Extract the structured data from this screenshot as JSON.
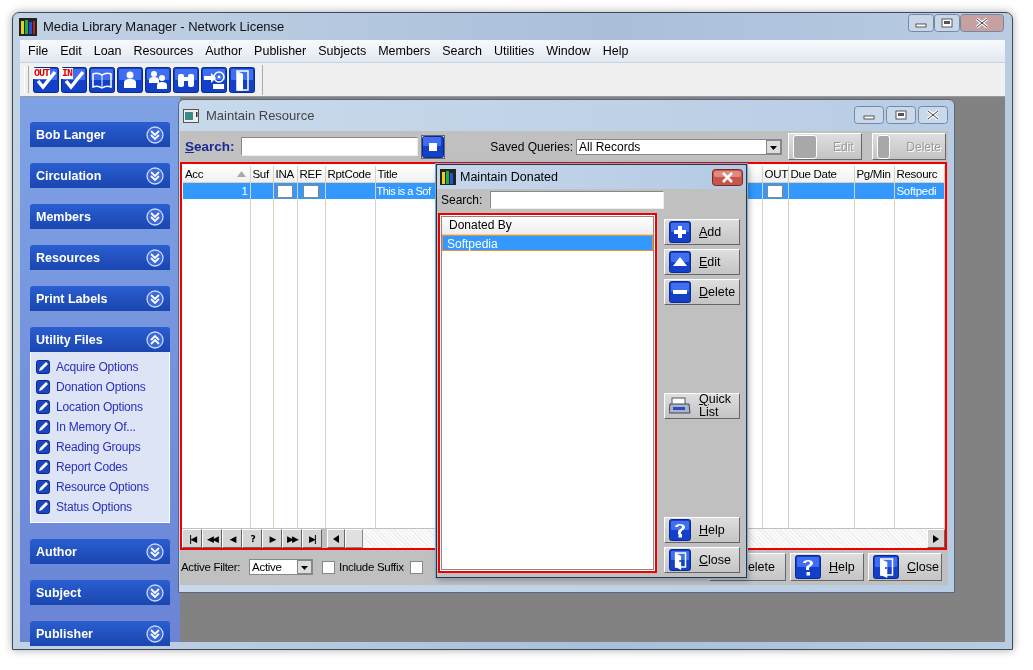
{
  "window": {
    "title": "Media Library Manager - Network License"
  },
  "menu": [
    "File",
    "Edit",
    "Loan",
    "Resources",
    "Author",
    "Publisher",
    "Subjects",
    "Members",
    "Search",
    "Utilities",
    "Window",
    "Help"
  ],
  "toolbar": [
    {
      "kind": "out",
      "label": "OUT"
    },
    {
      "kind": "in",
      "label": "IN"
    },
    {
      "kind": "book"
    },
    {
      "kind": "person"
    },
    {
      "kind": "people"
    },
    {
      "kind": "binoculars"
    },
    {
      "kind": "import"
    },
    {
      "kind": "door"
    }
  ],
  "sidebar": [
    {
      "title": "Bob Langer",
      "expanded": false
    },
    {
      "title": "Circulation",
      "expanded": false
    },
    {
      "title": "Members",
      "expanded": false
    },
    {
      "title": "Resources",
      "expanded": false
    },
    {
      "title": "Print Labels",
      "expanded": false
    },
    {
      "title": "Utility Files",
      "expanded": true,
      "items": [
        "Acquire Options",
        "Donation Options",
        "Location Options",
        "In Memory Of...",
        "Reading Groups",
        "Report Codes",
        "Resource Options",
        "Status Options"
      ]
    },
    {
      "title": "Author",
      "expanded": false
    },
    {
      "title": "Subject",
      "expanded": false
    },
    {
      "title": "Publisher",
      "expanded": false
    }
  ],
  "resource_window": {
    "title": "Maintain Resource",
    "search_label": "Search:",
    "saved_queries_label": "Saved Queries:",
    "saved_query": "All Records",
    "buttons": [
      {
        "label": "Edit",
        "disabled": true
      },
      {
        "label": "Delete",
        "disabled": true
      }
    ],
    "table": {
      "columns": [
        {
          "label": "Acc",
          "sorted": true
        },
        {
          "label": "Suf",
          "sorted": false
        },
        {
          "label": "INA",
          "sorted": false
        },
        {
          "label": "REF",
          "sorted": false
        },
        {
          "label": "RptCode",
          "sorted": false
        },
        {
          "label": "Title",
          "sorted": false
        },
        {
          "label": "OUT",
          "sorted": false
        },
        {
          "label": "Due Date",
          "sorted": false
        },
        {
          "label": "Pg/Min",
          "sorted": false
        },
        {
          "label": "Resourc",
          "sorted": false
        }
      ],
      "rows": [
        {
          "selected": true,
          "cells": [
            {
              "kind": "number",
              "text": "1"
            },
            {
              "kind": "empty"
            },
            {
              "kind": "checkbox",
              "checked": false
            },
            {
              "kind": "checkbox",
              "checked": false
            },
            {
              "kind": "empty"
            },
            {
              "kind": "text",
              "text": "This is a Sof"
            },
            {
              "kind": "checkbox",
              "checked": false
            },
            {
              "kind": "empty"
            },
            {
              "kind": "empty"
            },
            {
              "kind": "text",
              "text": "Softpedi"
            }
          ]
        }
      ]
    },
    "navigator": [
      "|◀",
      "◀◀",
      "◀",
      "?",
      "▶",
      "▶▶",
      "▶|"
    ],
    "active_filter_label": "Active Filter:",
    "active_filter": "Active",
    "checkboxes": [
      {
        "label": "Include Suffix",
        "checked": false
      },
      {
        "checked": false
      }
    ],
    "bottom_buttons": [
      {
        "kind": "delete",
        "label": "elete"
      },
      {
        "kind": "help",
        "label": "Help"
      },
      {
        "kind": "close",
        "label": "Close"
      }
    ]
  },
  "dialog": {
    "title": "Maintain Donated",
    "search_label": "Search:",
    "list": {
      "header": "Donated By",
      "rows": [
        {
          "text": "Softpedia",
          "selected": true
        }
      ]
    },
    "buttons": [
      {
        "kind": "add",
        "label": "Add"
      },
      {
        "kind": "edit",
        "label": "Edit"
      },
      {
        "kind": "delete",
        "label": "Delete"
      },
      {
        "kind": "print",
        "label": "Quick List"
      },
      {
        "kind": "help",
        "label": "Help"
      },
      {
        "kind": "close",
        "label": "Close"
      }
    ]
  }
}
